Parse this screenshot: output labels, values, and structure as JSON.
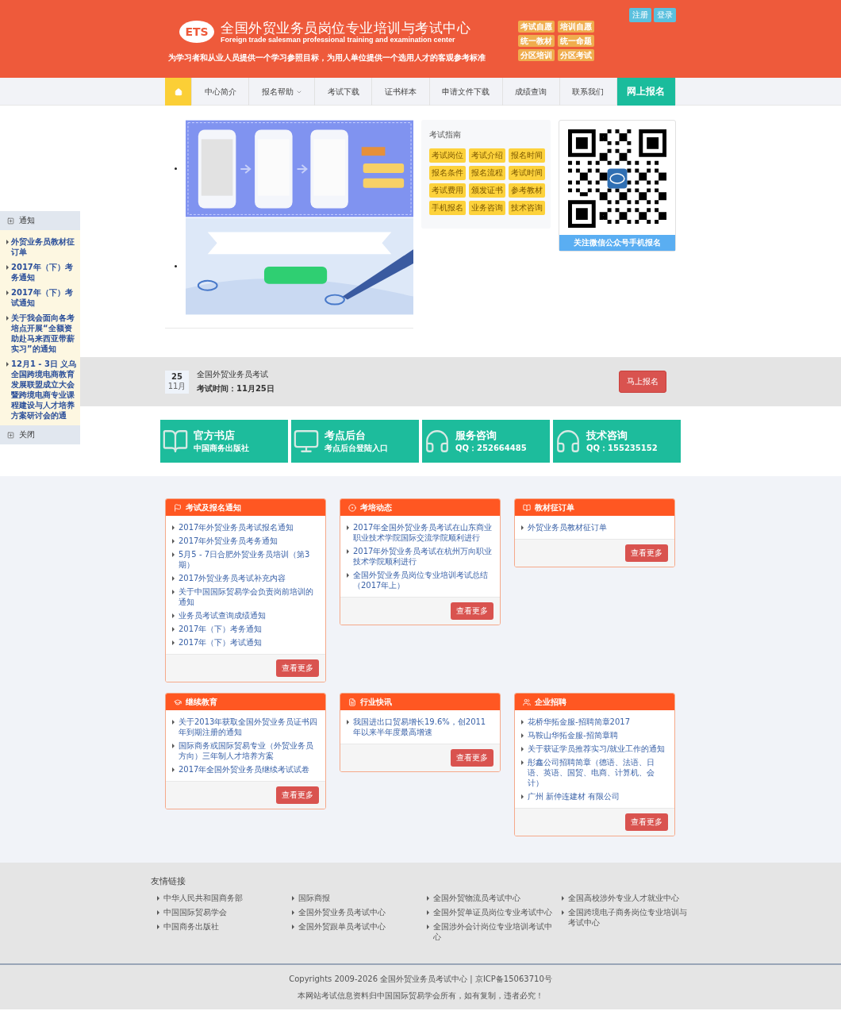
{
  "header": {
    "logo_text": "ETS",
    "title": "全国外贸业务员岗位专业培训与考试中心",
    "subtitle": "Foreign trade salesman professional training and examination center",
    "slogan": "为学习者和从业人员提供一个学习参照目标，为用人单位提供一个选用人才的客观参考标准",
    "tags": [
      "考试自愿",
      "培训自愿",
      "统一教材",
      "统一命题",
      "分区培训",
      "分区考试"
    ],
    "auth_buttons": [
      "注册",
      "登录"
    ]
  },
  "nav": [
    {
      "kind": "home",
      "selected": true
    },
    {
      "kind": "link",
      "label": "中心简介",
      "selected": false
    },
    {
      "kind": "dropdown",
      "label": "报名帮助",
      "selected": false
    },
    {
      "kind": "link",
      "label": "考试下载",
      "selected": false
    },
    {
      "kind": "link",
      "label": "证书样本",
      "selected": false
    },
    {
      "kind": "link",
      "label": "申请文件下载",
      "selected": false
    },
    {
      "kind": "link",
      "label": "成绩查询",
      "selected": false
    },
    {
      "kind": "link",
      "label": "联系我们",
      "selected": false
    },
    {
      "kind": "cta",
      "label": "网上报名",
      "selected": false
    }
  ],
  "sidebar": {
    "title": "通知",
    "items": [
      "外贸业务员教材征订单",
      "2017年（下）考务通知",
      "2017年（下）考试通知",
      "关于我会面向各考培点开展“全额资助赴马来西亚带薪实习”的通知",
      "12月1 - 3日 义乌全国跨境电商教育发展联盟成立大会暨跨境电商专业课程建设与人才培养方案研讨会的通"
    ],
    "close_label": "关闭"
  },
  "guide": {
    "title": "考试指南",
    "buttons": [
      "考试岗位",
      "考试介绍",
      "报名时间",
      "报名条件",
      "报名流程",
      "考试时间",
      "考试费用",
      "颁发证书",
      "参考教材",
      "手机报名",
      "业务咨询",
      "技术咨询"
    ]
  },
  "qr": {
    "caption": "关注微信公众号手机报名"
  },
  "event": {
    "day": "25",
    "month": "11月",
    "title": "全国外贸业务员考试",
    "time": "考试时间：11月25日",
    "button": "马上报名"
  },
  "tiles": [
    {
      "kind": "book",
      "title": "官方书店",
      "subtitle": "中国商务出版社"
    },
    {
      "kind": "monitor",
      "title": "考点后台",
      "subtitle": "考点后台登陆入口"
    },
    {
      "kind": "headset",
      "title": "服务咨询",
      "subtitle": "QQ：252664485"
    },
    {
      "kind": "headset",
      "title": "技术咨询",
      "subtitle": "QQ：155235152"
    }
  ],
  "panels": [
    {
      "kind": "flag",
      "title": "考试及报名通知",
      "items": [
        "2017年外贸业务员考试报名通知",
        "2017年外贸业务员考务通知",
        "5月5 - 7日合肥外贸业务员培训（第3期）",
        "2017外贸业务员考试补充内容",
        "关于中国国际贸易学会负责岗前培训的通知",
        "业务员考试查询成绩通知",
        "2017年（下）考务通知",
        "2017年（下）考试通知"
      ],
      "more": "查看更多"
    },
    {
      "kind": "dot",
      "title": "考培动态",
      "items": [
        "2017年全国外贸业务员考试在山东商业职业技术学院国际交流学院顺利进行",
        "2017年外贸业务员考试在杭州万向职业技术学院顺利进行",
        "全国外贸业务员岗位专业培训考试总结（2017年上）"
      ],
      "more": "查看更多"
    },
    {
      "kind": "book",
      "title": "教材征订单",
      "items": [
        "外贸业务员教材征订单"
      ],
      "more": "查看更多"
    },
    {
      "kind": "cap",
      "title": "继续教育",
      "items": [
        "关于2013年获取全国外贸业务员证书四年到期注册的通知",
        "国际商务或国际贸易专业（外贸业务员方向）三年制人才培养方案",
        "2017年全国外贸业务员继续考试试卷"
      ],
      "more": "查看更多"
    },
    {
      "kind": "doc",
      "title": "行业快讯",
      "items": [
        "我国进出口贸易增长19.6%，创2011年以来半年度最高增速"
      ],
      "more": "查看更多"
    },
    {
      "kind": "users",
      "title": "企业招聘",
      "items": [
        "花桥华拓金服-招聘简章2017",
        "马鞍山华拓金服-招简章聘",
        "关于获证学员推荐实习/就业工作的通知",
        "彤鑫公司招聘简章（德语、法语、日语、英语、国贸、电商、计算机、会计）",
        "广州 新仲连建材 有限公司"
      ],
      "more": "查看更多"
    }
  ],
  "footer": {
    "title": "友情链接",
    "columns": [
      [
        "中华人民共和国商务部",
        "中国国际贸易学会",
        "中国商务出版社"
      ],
      [
        "国际商报",
        "全国外贸业务员考试中心",
        "全国外贸跟单员考试中心"
      ],
      [
        "全国外贸物流员考试中心",
        "全国外贸单证员岗位专业考试中心",
        "全国涉外会计岗位专业培训考试中心"
      ],
      [
        "全国高校涉外专业人才就业中心",
        "全国跨境电子商务岗位专业培训与考试中心"
      ]
    ],
    "copyright": "Copyrights 2009-2026 全国外贸业务员考试中心 | 京ICP备15063710号",
    "notice": "本网站考试信息资料归中国国际贸易学会所有，如有复制，违者必究！"
  }
}
